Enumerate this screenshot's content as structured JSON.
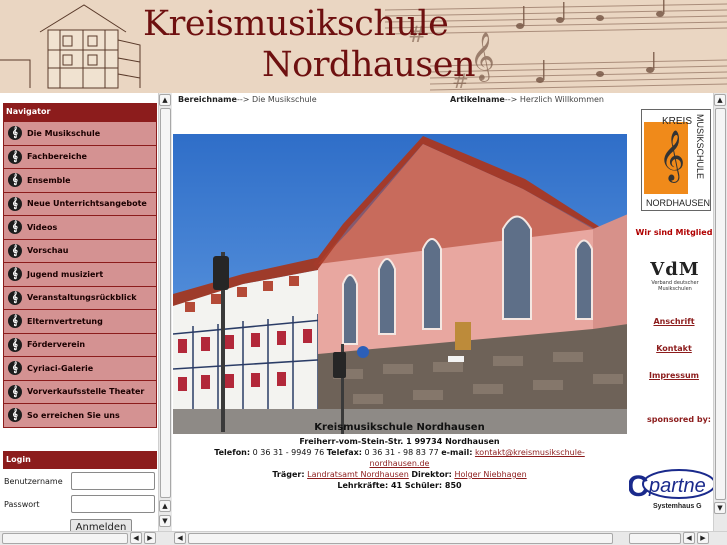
{
  "header": {
    "title_line1": "Kreismusikschule",
    "title_line2": "Nordhausen"
  },
  "navigator": {
    "title": "Navigator",
    "items": [
      {
        "label": "Die Musikschule"
      },
      {
        "label": "Fachbereiche"
      },
      {
        "label": "Ensemble"
      },
      {
        "label": "Neue Unterrichtsangebote"
      },
      {
        "label": "Videos"
      },
      {
        "label": "Vorschau"
      },
      {
        "label": "Jugend musiziert"
      },
      {
        "label": "Veranstaltungsrückblick"
      },
      {
        "label": "Elternvertretung"
      },
      {
        "label": "Förderverein"
      },
      {
        "label": "Cyriaci-Galerie"
      },
      {
        "label": "Vorverkaufsstelle Theater"
      },
      {
        "label": "So erreichen Sie uns"
      }
    ]
  },
  "login": {
    "title": "Login",
    "username_label": "Benutzername",
    "password_label": "Passwort",
    "submit_label": "Anmelden"
  },
  "breadcrumb": {
    "area_label": "Bereichname",
    "area_sep": "-->",
    "area_value": "Die Musikschule",
    "article_label": "Artikelname",
    "article_sep": "-->",
    "article_value": "Herzlich Willkommen"
  },
  "info": {
    "title": "Kreismusikschule Nordhausen",
    "address": "Freiherr-vom-Stein-Str. 1   99734 Nordhausen",
    "phone_label": "Telefon:",
    "phone": "0 36 31 - 9949 76",
    "fax_label": "Telefax:",
    "fax": "0 36 31 - 98 83 77",
    "email_label": "e-mail:",
    "email_part1": "kontakt@kreismusikschule-",
    "email_part2": "nordhausen.de",
    "traeger_label": "Träger:",
    "traeger": "Landratsamt Nordhausen",
    "director_label": "Direktor:",
    "director": "Holger Niebhagen",
    "teachers_label": "Lehrkräfte:",
    "teachers": "41",
    "students_label": "Schüler:",
    "students": "850"
  },
  "right": {
    "logo_text_top": "KREIS",
    "logo_text_side": "MUSIKSCHULE",
    "logo_text_bottom": "NORDHAUSEN",
    "member_text": "Wir sind Mitglied",
    "vdm_logo": "VdM",
    "vdm_sub1": "Verband deutscher",
    "vdm_sub2": "Musikschulen",
    "links": [
      "Anschrift",
      "Kontakt",
      "Impressum"
    ],
    "sponsor_text": "sponsored by:",
    "partner_logo": "partne",
    "partner_sub": "Systemhaus G"
  },
  "colors": {
    "brand": "#8c1c1c",
    "nav_bg": "#d49292",
    "header_bg": "#ead6c2"
  }
}
